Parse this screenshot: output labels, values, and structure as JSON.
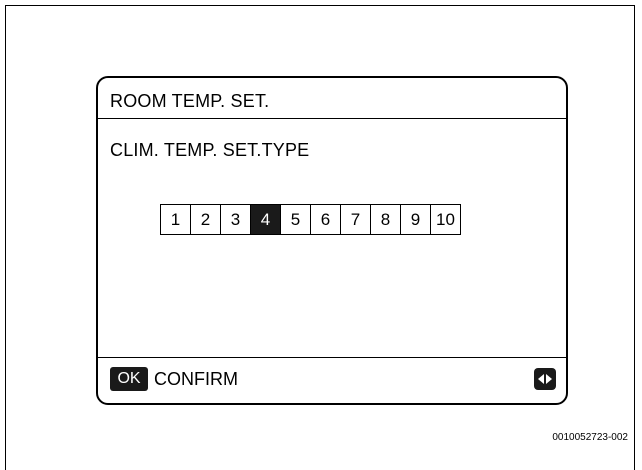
{
  "screen": {
    "title": "ROOM TEMP. SET.",
    "subtitle": "CLIM. TEMP. SET.TYPE",
    "options": [
      "1",
      "2",
      "3",
      "4",
      "5",
      "6",
      "7",
      "8",
      "9",
      "10"
    ],
    "selected_value": "4"
  },
  "footer": {
    "ok_key_label": "OK",
    "confirm_label": "CONFIRM",
    "nav_icon": "left-right-arrows-icon"
  },
  "figure_code": "0010052723-002",
  "colors": {
    "selected_bg": "#1a1a1a",
    "selected_fg": "#ffffff",
    "border": "#000000"
  }
}
